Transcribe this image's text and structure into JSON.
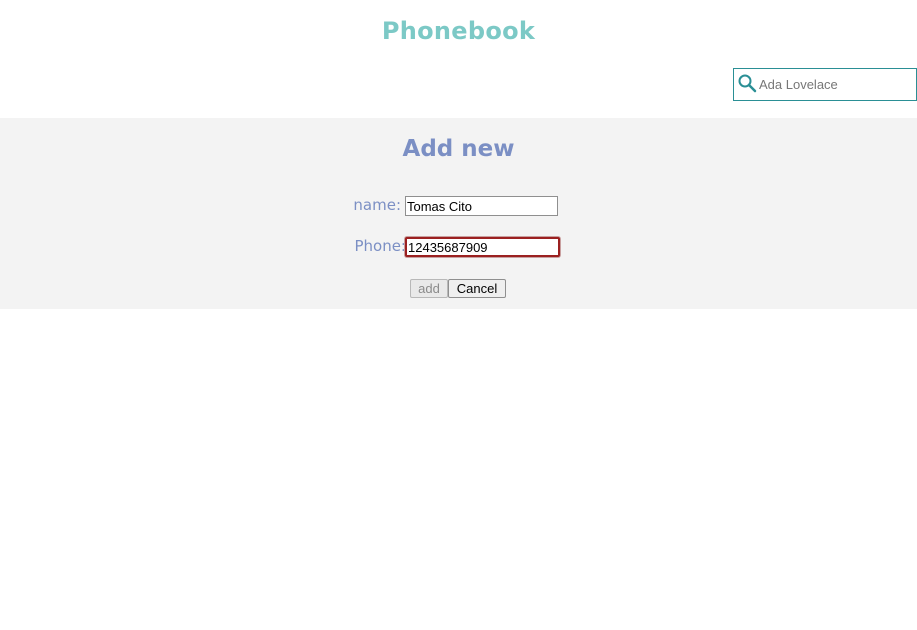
{
  "header": {
    "title": "Phonebook"
  },
  "search": {
    "placeholder": "Ada Lovelace",
    "value": "",
    "icon": "search-icon"
  },
  "add_form": {
    "title": "Add new",
    "name_label": "name:",
    "name_value": "Tomas Cito",
    "phone_label": "Phone:",
    "phone_value": "12435687909",
    "add_button": "add",
    "cancel_button": "Cancel"
  },
  "colors": {
    "title": "#7cc9c6",
    "panel_title": "#7b8fc4",
    "panel_background": "#f3f3f3",
    "search_border": "#2a8f95",
    "focused_border": "#9b2020"
  }
}
